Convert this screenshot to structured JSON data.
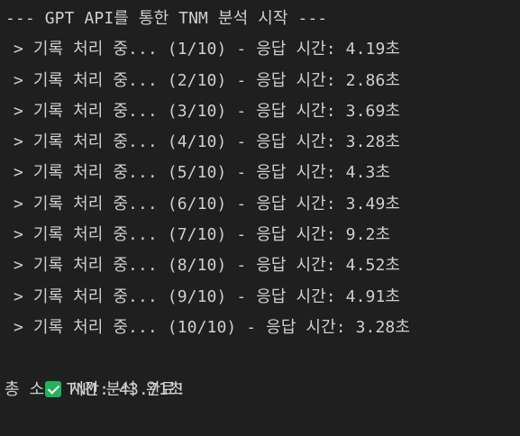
{
  "terminal": {
    "header": "--- GPT API를 통한 TNM 분석 시작 ---",
    "logs": [
      "> 기록 처리 중... (1/10) - 응답 시간: 4.19초",
      "> 기록 처리 중... (2/10) - 응답 시간: 2.86초",
      "> 기록 처리 중... (3/10) - 응답 시간: 3.69초",
      "> 기록 처리 중... (4/10) - 응답 시간: 3.28초",
      "> 기록 처리 중... (5/10) - 응답 시간: 4.3초",
      "> 기록 처리 중... (6/10) - 응답 시간: 3.49초",
      "> 기록 처리 중... (7/10) - 응답 시간: 9.2초",
      "> 기록 처리 중... (8/10) - 응답 시간: 4.52초",
      "> 기록 처리 중... (9/10) - 응답 시간: 4.91초",
      "> 기록 처리 중... (10/10) - 응답 시간: 3.28초"
    ],
    "done_icon": "check-mark-icon",
    "done_text": "TNM 분석 완료!",
    "total_text": "총 소요 시간: 43.71초"
  },
  "colors": {
    "background": "#1f1f1f",
    "text": "#cfcfcf",
    "check_green": "#1fb35b"
  }
}
